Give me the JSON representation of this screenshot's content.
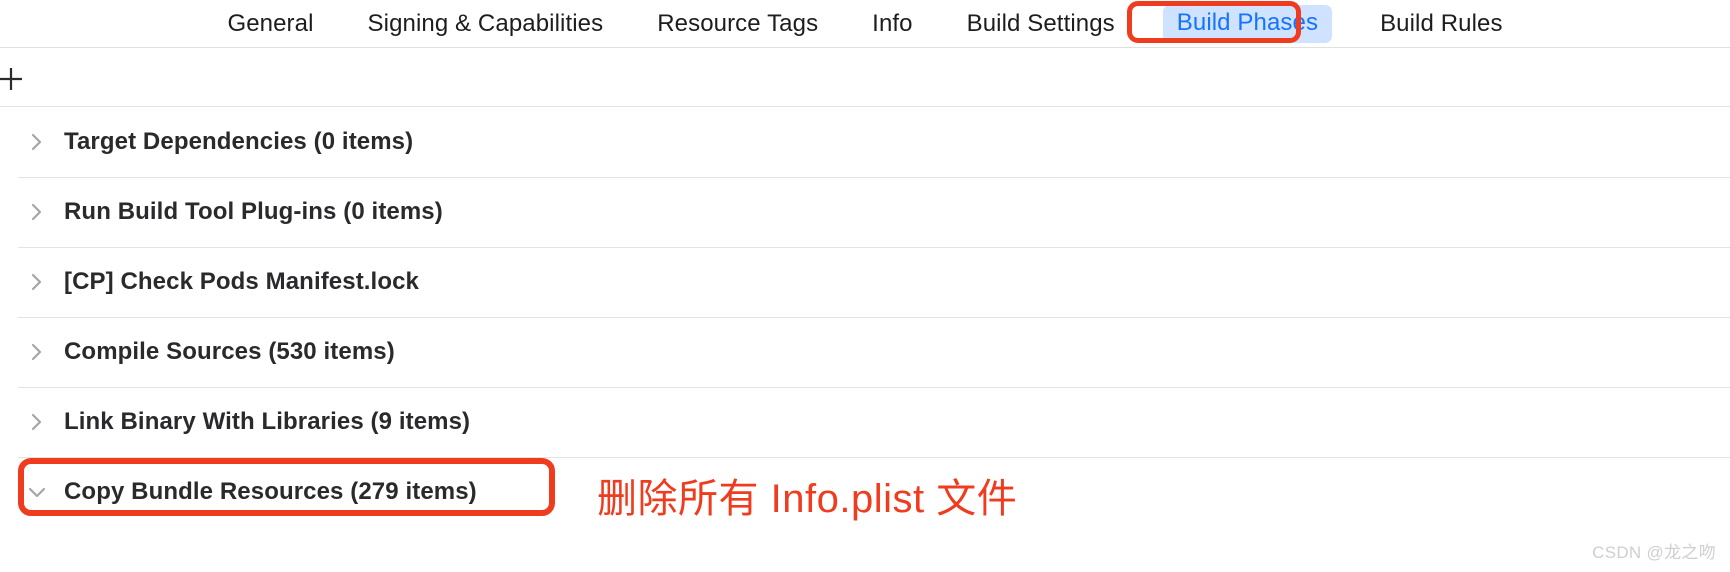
{
  "tabbar": {
    "tabs": [
      {
        "label": "General",
        "selected": false
      },
      {
        "label": "Signing & Capabilities",
        "selected": false
      },
      {
        "label": "Resource Tags",
        "selected": false
      },
      {
        "label": "Info",
        "selected": false
      },
      {
        "label": "Build Settings",
        "selected": false
      },
      {
        "label": "Build Phases",
        "selected": true
      },
      {
        "label": "Build Rules",
        "selected": false
      }
    ]
  },
  "toolbar": {
    "add_label": "+",
    "add_icon": "plus-icon"
  },
  "phases": [
    {
      "label": "Target Dependencies (0 items)",
      "expanded": false,
      "icon": "chevron-right-icon"
    },
    {
      "label": "Run Build Tool Plug-ins (0 items)",
      "expanded": false,
      "icon": "chevron-right-icon"
    },
    {
      "label": "[CP] Check Pods Manifest.lock",
      "expanded": false,
      "icon": "chevron-right-icon"
    },
    {
      "label": "Compile Sources (530 items)",
      "expanded": false,
      "icon": "chevron-right-icon"
    },
    {
      "label": "Link Binary With Libraries (9 items)",
      "expanded": false,
      "icon": "chevron-right-icon"
    },
    {
      "label": "Copy Bundle Resources (279 items)",
      "expanded": true,
      "icon": "chevron-down-icon"
    }
  ],
  "annotations": {
    "color": "#ef3c1f",
    "tab_highlight_target": "Build Phases",
    "row_highlight_target": "Copy Bundle Resources (279 items)",
    "note_text": "删除所有 Info.plist 文件"
  },
  "watermark": {
    "text": "CSDN @龙之吻"
  },
  "colors": {
    "selected_tab_text": "#1473ff",
    "selected_tab_bg": "#cfe2ff",
    "annotation_red": "#ef3c1f",
    "row_text": "#2a2a2c",
    "separator": "#e3e3e3"
  }
}
